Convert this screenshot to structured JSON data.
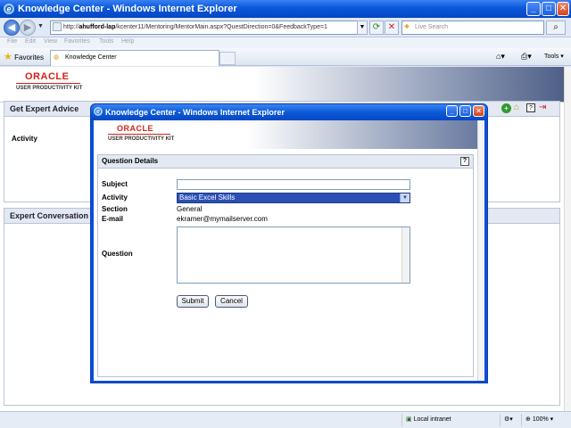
{
  "window": {
    "title": "Knowledge Center - Windows Internet Explorer",
    "min": "_",
    "max": "□",
    "close": "✕"
  },
  "address": {
    "url_prefix": "http://",
    "url_host": "ahufford-lap",
    "url_path": "/kcenter11/Mentoring/MentorMain.aspx?QuestDirection=0&FeedbackType=1",
    "search_placeholder": "Live Search"
  },
  "menu": [
    "File",
    "Edit",
    "View",
    "Favorites",
    "Tools",
    "Help"
  ],
  "favbar": {
    "favorites_label": "Favorites",
    "tab_label": "Knowledge Center",
    "tools_label": "Tools"
  },
  "brand": {
    "oracle": "ORACLE",
    "upk": "USER PRODUCTIVITY KIT"
  },
  "main": {
    "get_expert_advice": "Get Expert Advice",
    "activity_label": "Activity",
    "expert_conversation": "Expert Conversation"
  },
  "popup": {
    "title": "Knowledge Center - Windows Internet Explorer",
    "section_title": "Question Details",
    "help": "?",
    "subject_label": "Subject",
    "subject_value": "",
    "activity_label": "Activity",
    "activity_value": "Basic Excel Skills",
    "section_label": "Section",
    "section_value": "General",
    "email_label": "E-mail",
    "email_value": "ekramer@mymailserver.com",
    "question_label": "Question",
    "question_value": "",
    "submit": "Submit",
    "cancel": "Cancel"
  },
  "status": {
    "zone": "Local intranet",
    "zoom": "100%"
  }
}
